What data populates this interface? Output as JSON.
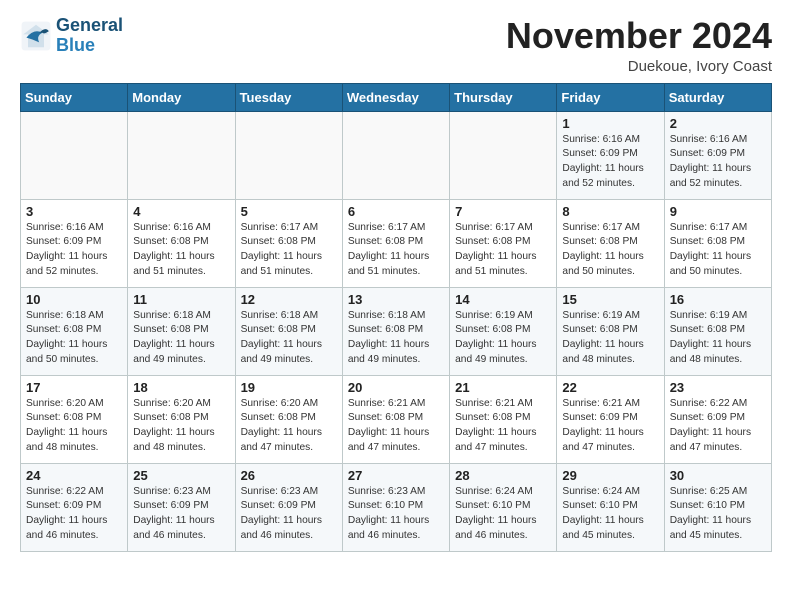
{
  "header": {
    "logo_line1": "General",
    "logo_line2": "Blue",
    "month_title": "November 2024",
    "subtitle": "Duekoue, Ivory Coast"
  },
  "weekdays": [
    "Sunday",
    "Monday",
    "Tuesday",
    "Wednesday",
    "Thursday",
    "Friday",
    "Saturday"
  ],
  "weeks": [
    [
      {
        "day": "",
        "info": ""
      },
      {
        "day": "",
        "info": ""
      },
      {
        "day": "",
        "info": ""
      },
      {
        "day": "",
        "info": ""
      },
      {
        "day": "",
        "info": ""
      },
      {
        "day": "1",
        "info": "Sunrise: 6:16 AM\nSunset: 6:09 PM\nDaylight: 11 hours\nand 52 minutes."
      },
      {
        "day": "2",
        "info": "Sunrise: 6:16 AM\nSunset: 6:09 PM\nDaylight: 11 hours\nand 52 minutes."
      }
    ],
    [
      {
        "day": "3",
        "info": "Sunrise: 6:16 AM\nSunset: 6:09 PM\nDaylight: 11 hours\nand 52 minutes."
      },
      {
        "day": "4",
        "info": "Sunrise: 6:16 AM\nSunset: 6:08 PM\nDaylight: 11 hours\nand 51 minutes."
      },
      {
        "day": "5",
        "info": "Sunrise: 6:17 AM\nSunset: 6:08 PM\nDaylight: 11 hours\nand 51 minutes."
      },
      {
        "day": "6",
        "info": "Sunrise: 6:17 AM\nSunset: 6:08 PM\nDaylight: 11 hours\nand 51 minutes."
      },
      {
        "day": "7",
        "info": "Sunrise: 6:17 AM\nSunset: 6:08 PM\nDaylight: 11 hours\nand 51 minutes."
      },
      {
        "day": "8",
        "info": "Sunrise: 6:17 AM\nSunset: 6:08 PM\nDaylight: 11 hours\nand 50 minutes."
      },
      {
        "day": "9",
        "info": "Sunrise: 6:17 AM\nSunset: 6:08 PM\nDaylight: 11 hours\nand 50 minutes."
      }
    ],
    [
      {
        "day": "10",
        "info": "Sunrise: 6:18 AM\nSunset: 6:08 PM\nDaylight: 11 hours\nand 50 minutes."
      },
      {
        "day": "11",
        "info": "Sunrise: 6:18 AM\nSunset: 6:08 PM\nDaylight: 11 hours\nand 49 minutes."
      },
      {
        "day": "12",
        "info": "Sunrise: 6:18 AM\nSunset: 6:08 PM\nDaylight: 11 hours\nand 49 minutes."
      },
      {
        "day": "13",
        "info": "Sunrise: 6:18 AM\nSunset: 6:08 PM\nDaylight: 11 hours\nand 49 minutes."
      },
      {
        "day": "14",
        "info": "Sunrise: 6:19 AM\nSunset: 6:08 PM\nDaylight: 11 hours\nand 49 minutes."
      },
      {
        "day": "15",
        "info": "Sunrise: 6:19 AM\nSunset: 6:08 PM\nDaylight: 11 hours\nand 48 minutes."
      },
      {
        "day": "16",
        "info": "Sunrise: 6:19 AM\nSunset: 6:08 PM\nDaylight: 11 hours\nand 48 minutes."
      }
    ],
    [
      {
        "day": "17",
        "info": "Sunrise: 6:20 AM\nSunset: 6:08 PM\nDaylight: 11 hours\nand 48 minutes."
      },
      {
        "day": "18",
        "info": "Sunrise: 6:20 AM\nSunset: 6:08 PM\nDaylight: 11 hours\nand 48 minutes."
      },
      {
        "day": "19",
        "info": "Sunrise: 6:20 AM\nSunset: 6:08 PM\nDaylight: 11 hours\nand 47 minutes."
      },
      {
        "day": "20",
        "info": "Sunrise: 6:21 AM\nSunset: 6:08 PM\nDaylight: 11 hours\nand 47 minutes."
      },
      {
        "day": "21",
        "info": "Sunrise: 6:21 AM\nSunset: 6:08 PM\nDaylight: 11 hours\nand 47 minutes."
      },
      {
        "day": "22",
        "info": "Sunrise: 6:21 AM\nSunset: 6:09 PM\nDaylight: 11 hours\nand 47 minutes."
      },
      {
        "day": "23",
        "info": "Sunrise: 6:22 AM\nSunset: 6:09 PM\nDaylight: 11 hours\nand 47 minutes."
      }
    ],
    [
      {
        "day": "24",
        "info": "Sunrise: 6:22 AM\nSunset: 6:09 PM\nDaylight: 11 hours\nand 46 minutes."
      },
      {
        "day": "25",
        "info": "Sunrise: 6:23 AM\nSunset: 6:09 PM\nDaylight: 11 hours\nand 46 minutes."
      },
      {
        "day": "26",
        "info": "Sunrise: 6:23 AM\nSunset: 6:09 PM\nDaylight: 11 hours\nand 46 minutes."
      },
      {
        "day": "27",
        "info": "Sunrise: 6:23 AM\nSunset: 6:10 PM\nDaylight: 11 hours\nand 46 minutes."
      },
      {
        "day": "28",
        "info": "Sunrise: 6:24 AM\nSunset: 6:10 PM\nDaylight: 11 hours\nand 46 minutes."
      },
      {
        "day": "29",
        "info": "Sunrise: 6:24 AM\nSunset: 6:10 PM\nDaylight: 11 hours\nand 45 minutes."
      },
      {
        "day": "30",
        "info": "Sunrise: 6:25 AM\nSunset: 6:10 PM\nDaylight: 11 hours\nand 45 minutes."
      }
    ]
  ]
}
